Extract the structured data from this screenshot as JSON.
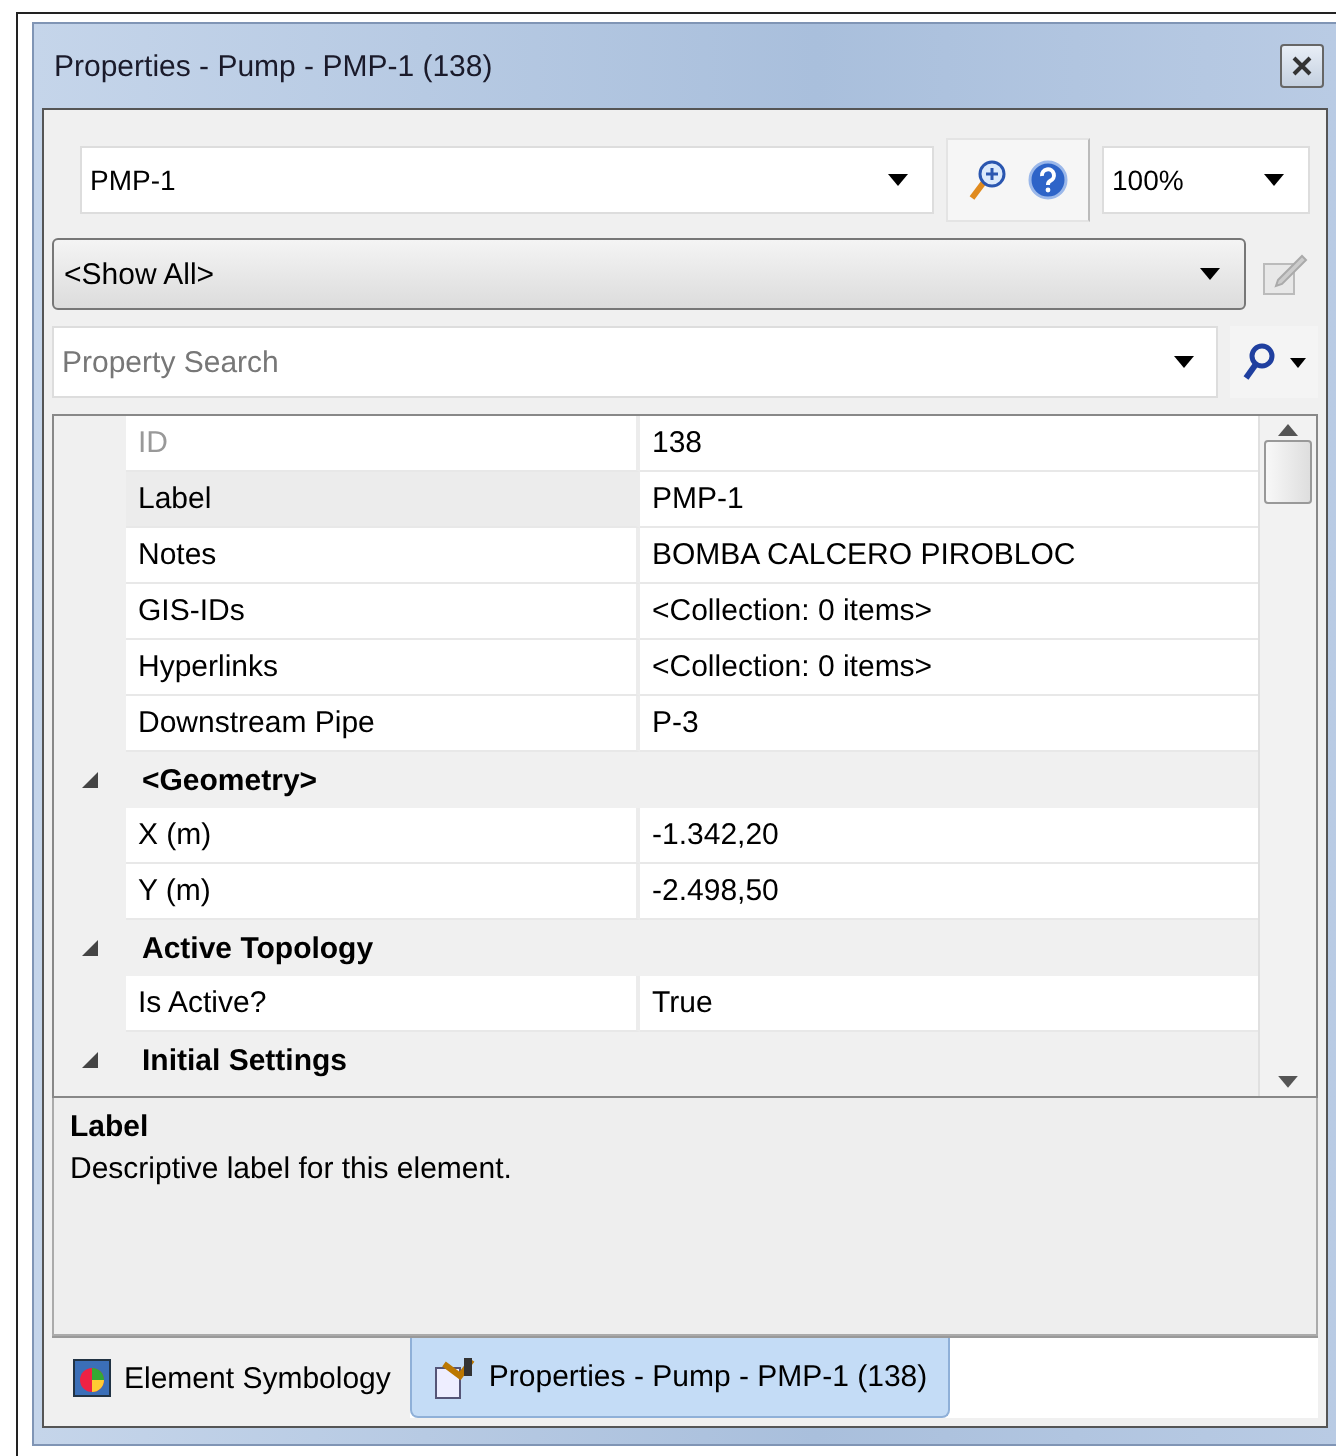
{
  "window": {
    "title": "Properties - Pump - PMP-1 (138)"
  },
  "toolbar": {
    "element_select": {
      "value": "PMP-1"
    },
    "zoom_select": {
      "value": "100%"
    }
  },
  "filter_select": {
    "value": "<Show All>"
  },
  "search": {
    "placeholder": "Property Search"
  },
  "grid": {
    "rows": [
      {
        "kind": "property",
        "name": "ID",
        "value": "138",
        "disabled": true,
        "selected": false
      },
      {
        "kind": "property",
        "name": "Label",
        "value": "PMP-1",
        "disabled": false,
        "selected": true
      },
      {
        "kind": "property",
        "name": "Notes",
        "value": "BOMBA CALCERO PIROBLOC",
        "disabled": false,
        "selected": false
      },
      {
        "kind": "property",
        "name": "GIS-IDs",
        "value": "<Collection: 0 items>",
        "disabled": false,
        "selected": false
      },
      {
        "kind": "property",
        "name": "Hyperlinks",
        "value": "<Collection: 0 items>",
        "disabled": false,
        "selected": false
      },
      {
        "kind": "property",
        "name": "Downstream Pipe",
        "value": "P-3",
        "disabled": false,
        "selected": false
      },
      {
        "kind": "category",
        "name": "<Geometry>",
        "expanded": true
      },
      {
        "kind": "property",
        "name": "X (m)",
        "value": "-1.342,20",
        "disabled": false,
        "selected": false
      },
      {
        "kind": "property",
        "name": "Y (m)",
        "value": "-2.498,50",
        "disabled": false,
        "selected": false
      },
      {
        "kind": "category",
        "name": "Active Topology",
        "expanded": true
      },
      {
        "kind": "property",
        "name": "Is Active?",
        "value": "True",
        "disabled": false,
        "selected": false
      },
      {
        "kind": "category",
        "name": "Initial Settings",
        "expanded": true
      }
    ]
  },
  "description": {
    "title": "Label",
    "text": "Descriptive label for this element."
  },
  "tabs": [
    {
      "label": "Element Symbology",
      "kind": "symbology",
      "selected": false
    },
    {
      "label": "Properties - Pump - PMP-1 (138)",
      "kind": "properties",
      "selected": true
    }
  ]
}
